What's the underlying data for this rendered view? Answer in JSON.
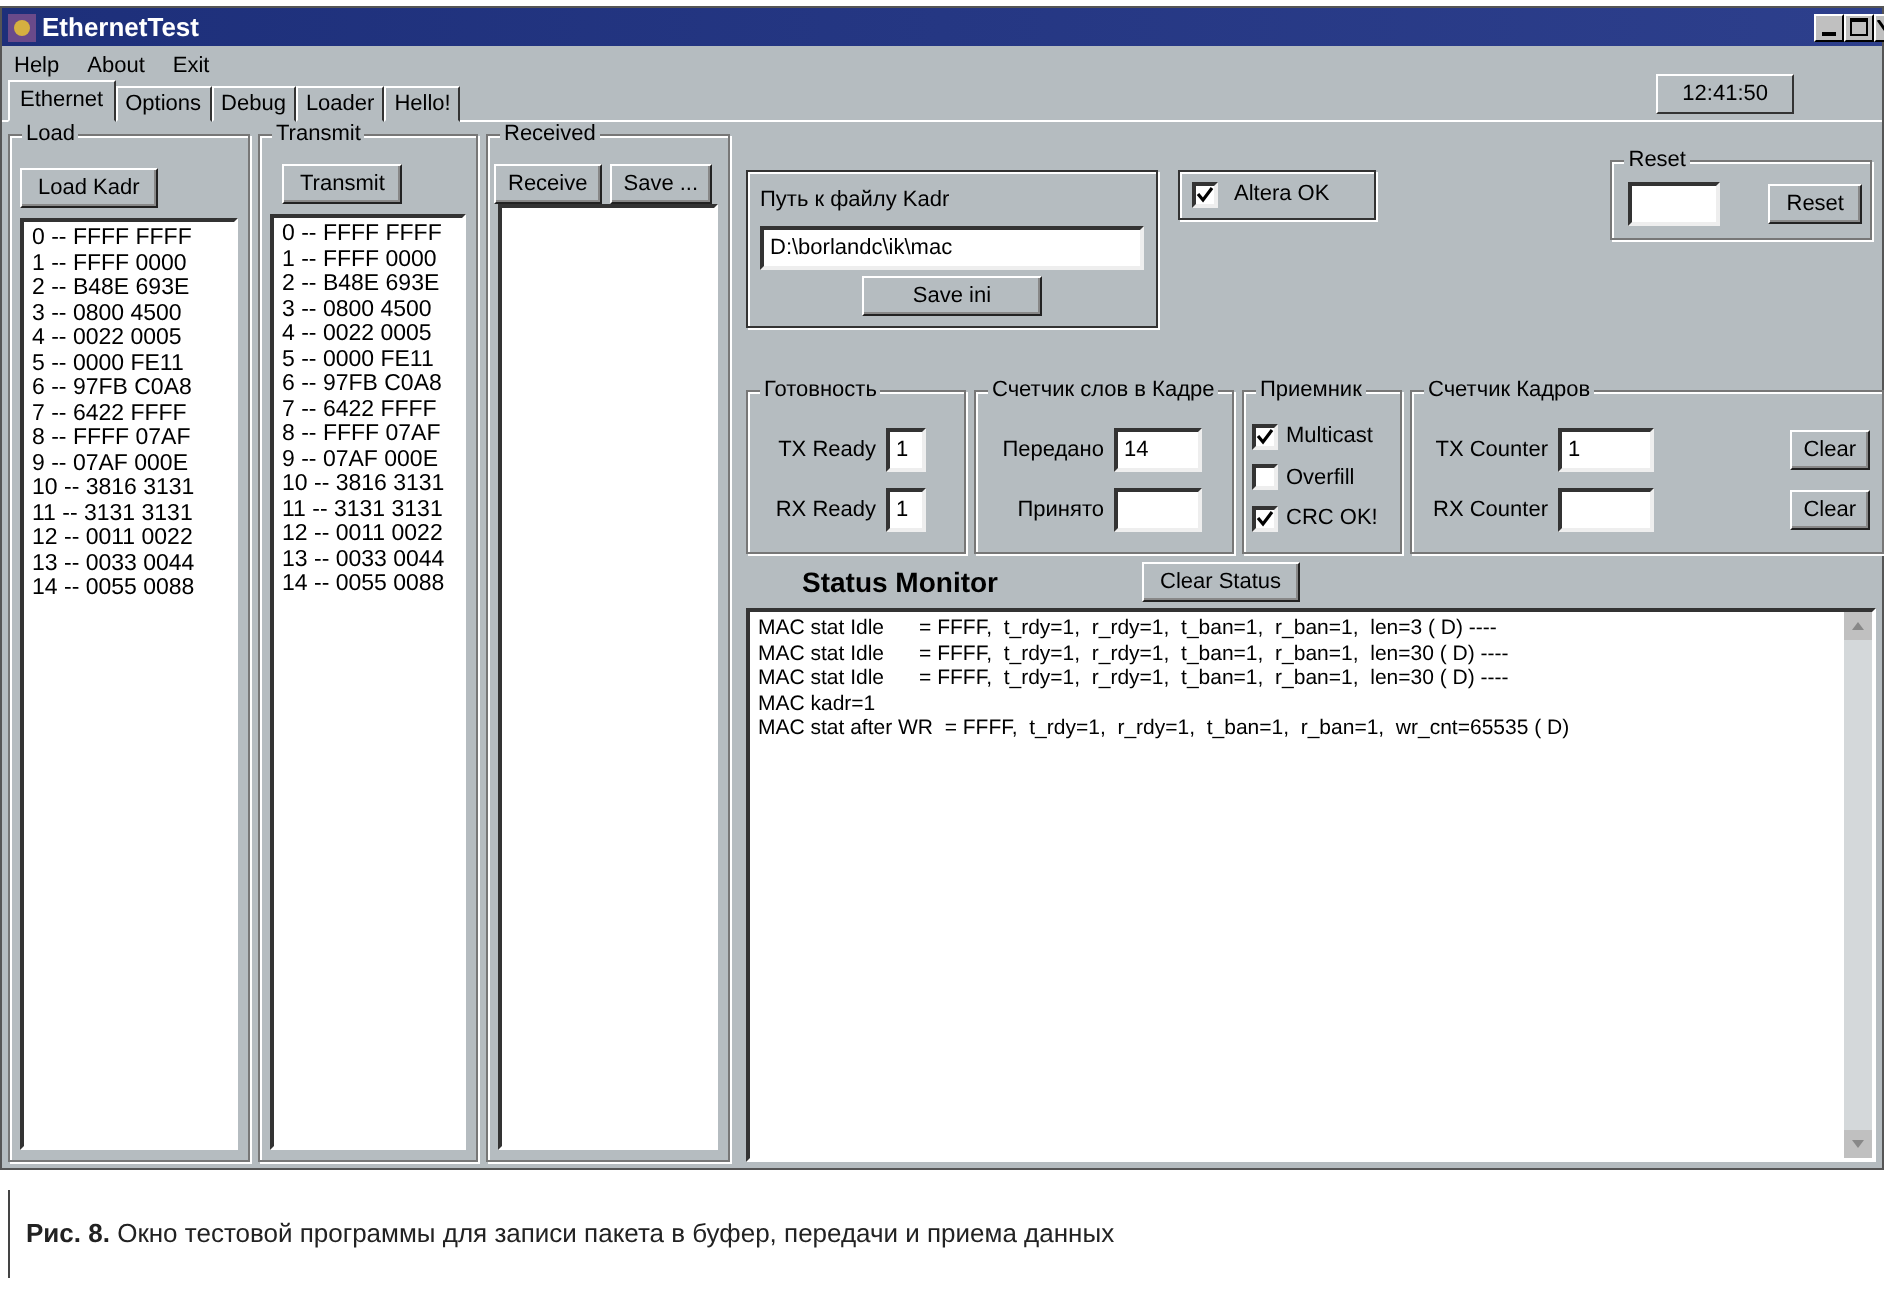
{
  "window": {
    "title": "EthernetTest"
  },
  "menu": [
    "Help",
    "About",
    "Exit"
  ],
  "tabs": [
    {
      "label": "Ethernet",
      "selected": true
    },
    {
      "label": "Options",
      "selected": false
    },
    {
      "label": "Debug",
      "selected": false
    },
    {
      "label": "Loader",
      "selected": false
    },
    {
      "label": "Hello!",
      "selected": false
    }
  ],
  "clock": "12:41:50",
  "load": {
    "title": "Load",
    "button": "Load Kadr",
    "rows": [
      "0 -- FFFF FFFF",
      "1 -- FFFF 0000",
      "2 -- B48E 693E",
      "3 -- 0800 4500",
      "4 -- 0022 0005",
      "5 -- 0000 FE11",
      "6 -- 97FB C0A8",
      "7 -- 6422 FFFF",
      "8 -- FFFF 07AF",
      "9 -- 07AF 000E",
      "10 -- 3816 3131",
      "11 -- 3131 3131",
      "12 -- 0011 0022",
      "13 -- 0033 0044",
      "14 -- 0055 0088"
    ]
  },
  "transmit": {
    "title": "Transmit",
    "button": "Transmit",
    "rows": [
      "0 -- FFFF FFFF",
      "1 -- FFFF 0000",
      "2 -- B48E 693E",
      "3 -- 0800 4500",
      "4 -- 0022 0005",
      "5 -- 0000 FE11",
      "6 -- 97FB C0A8",
      "7 -- 6422 FFFF",
      "8 -- FFFF 07AF",
      "9 -- 07AF 000E",
      "10 -- 3816 3131",
      "11 -- 3131 3131",
      "12 -- 0011 0022",
      "13 -- 0033 0044",
      "14 -- 0055 0088"
    ]
  },
  "received": {
    "title": "Received",
    "buttons": [
      "Receive",
      "Save ..."
    ]
  },
  "path_group": {
    "label": "Путь к файлу Kadr",
    "value": "D:\\borlandc\\ik\\mac",
    "button": "Save ini"
  },
  "altera": {
    "label": "Altera OK",
    "checked": true
  },
  "reset": {
    "title": "Reset",
    "button": "Reset"
  },
  "readiness": {
    "title": "Готовность",
    "fields": [
      {
        "label": "TX Ready",
        "value": "1"
      },
      {
        "label": "RX Ready",
        "value": "1"
      }
    ]
  },
  "word_counter": {
    "title": "Счетчик слов в Кадре",
    "fields": [
      {
        "label": "Передано",
        "value": "14"
      },
      {
        "label": "Принято"
      }
    ]
  },
  "receiver": {
    "title": "Приемник",
    "options": [
      {
        "label": "Multicast",
        "checked": true
      },
      {
        "label": "Overfill",
        "checked": false
      },
      {
        "label": "CRC OK!",
        "checked": true
      }
    ]
  },
  "frame_counter": {
    "title": "Счетчик Кадров",
    "fields": [
      {
        "label": "TX Counter",
        "value": "1",
        "button": "Clear"
      },
      {
        "label": "RX Counter",
        "button": "Clear"
      }
    ]
  },
  "status_monitor": {
    "title": "Status Monitor",
    "button": "Clear Status",
    "lines": [
      {
        "label": "MAC stat Idle",
        "value": "= FFFF,  t_rdy=1,  r_rdy=1,  t_ban=1,  r_ban=1,  len=3 ( D) ----"
      },
      {
        "label": "MAC stat Idle",
        "value": "= FFFF,  t_rdy=1,  r_rdy=1,  t_ban=1,  r_ban=1,  len=30 ( D) ----"
      },
      {
        "label": "MAC stat Idle",
        "value": "= FFFF,  t_rdy=1,  r_rdy=1,  t_ban=1,  r_ban=1,  len=30 ( D) ----"
      },
      {
        "label": "MAC kadr=1"
      },
      {
        "label": "MAC stat after WR",
        "value": "= FFFF,  t_rdy=1,  r_rdy=1,  t_ban=1,  r_ban=1,  wr_cnt=65535 ( D)"
      }
    ]
  },
  "caption": "**Рис. 8.** Окно тестовой программы для записи пакета в буфер, передачи и приема данных"
}
